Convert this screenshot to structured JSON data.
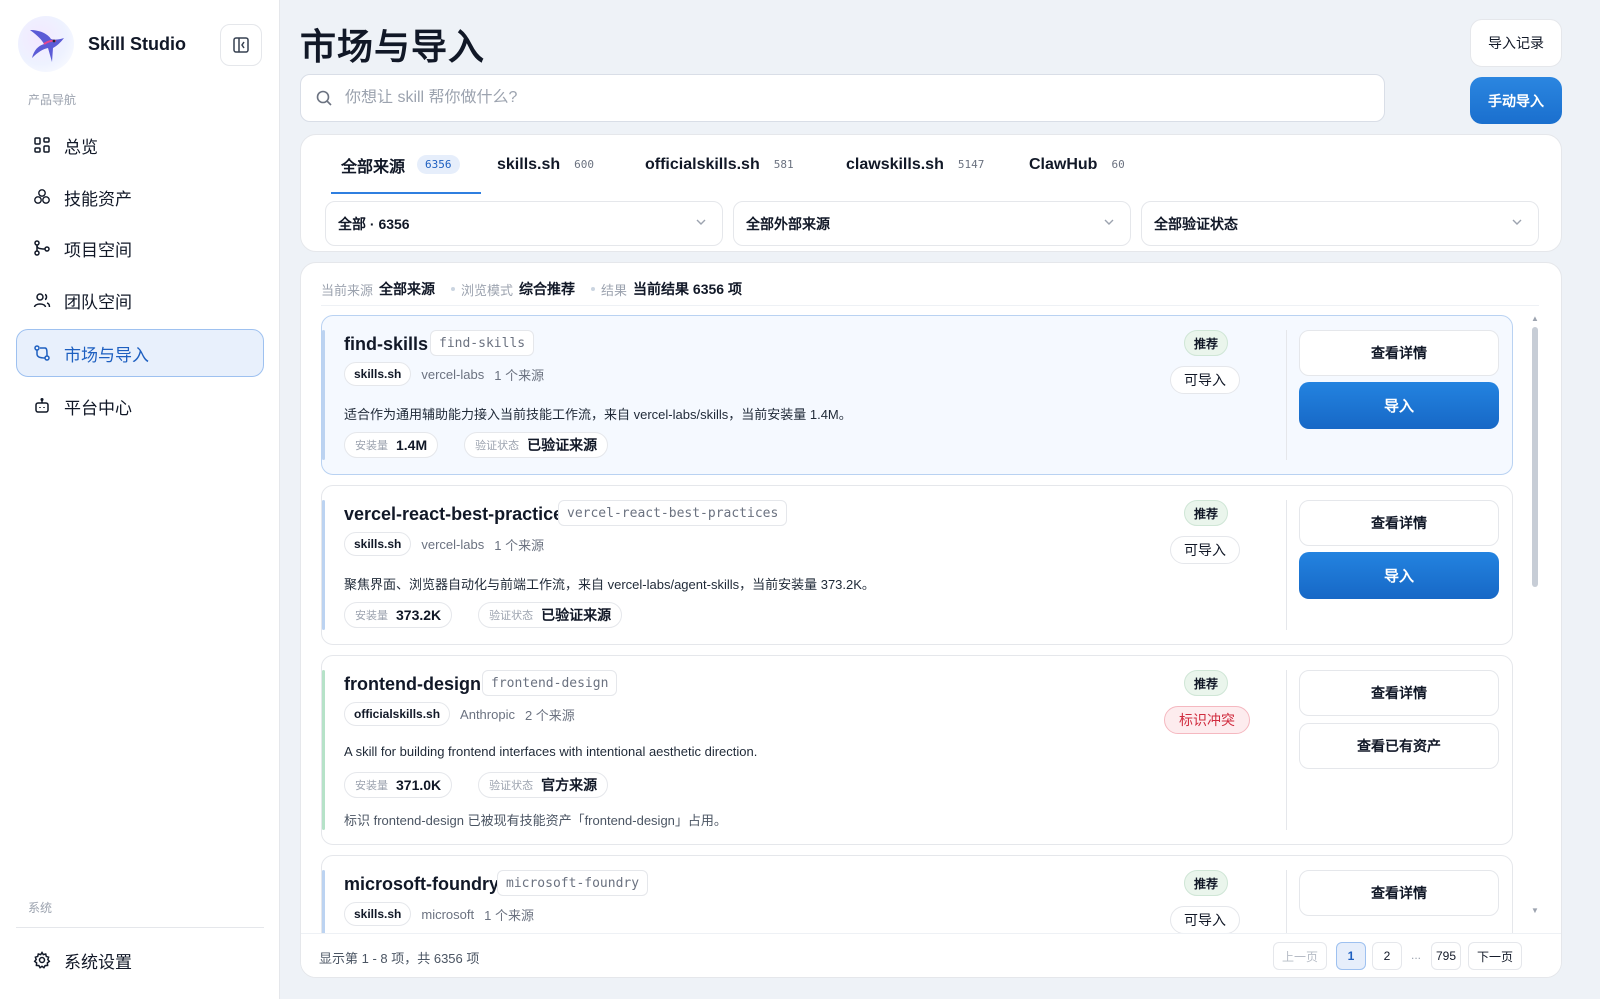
{
  "app": {
    "name": "Skill Studio"
  },
  "sidebar": {
    "section_product": "产品导航",
    "section_system": "系统",
    "items": [
      {
        "label": "总览",
        "icon": "grid-icon"
      },
      {
        "label": "技能资产",
        "icon": "cubes-icon"
      },
      {
        "label": "项目空间",
        "icon": "branch-icon"
      },
      {
        "label": "团队空间",
        "icon": "users-icon"
      },
      {
        "label": "市场与导入",
        "icon": "route-icon",
        "active": true
      },
      {
        "label": "平台中心",
        "icon": "bot-icon"
      }
    ],
    "settings": {
      "label": "系统设置",
      "icon": "gear-icon"
    }
  },
  "header": {
    "title": "市场与导入",
    "history_label": "导入记录",
    "manual_import_label": "手动导入"
  },
  "search": {
    "placeholder": "你想让 skill 帮你做什么?",
    "value": ""
  },
  "sources": {
    "tabs": [
      {
        "label": "全部来源",
        "count": "6356",
        "active": true
      },
      {
        "label": "skills.sh",
        "count": "600"
      },
      {
        "label": "officialskills.sh",
        "count": "581"
      },
      {
        "label": "clawskills.sh",
        "count": "5147"
      },
      {
        "label": "ClawHub",
        "count": "60"
      }
    ],
    "filters": [
      {
        "selected": "全部 · 6356"
      },
      {
        "selected": "全部外部来源"
      },
      {
        "selected": "全部验证状态"
      }
    ]
  },
  "results": {
    "meta": {
      "source_label": "当前来源",
      "source_value": "全部来源",
      "mode_label": "浏览模式",
      "mode_value": "综合推荐",
      "result_label": "结果",
      "result_value": "当前结果 6356 项"
    },
    "cards": [
      {
        "title": "find-skills",
        "slug": "find-skills",
        "source": "skills.sh",
        "owner": "vercel-labs",
        "source_count": "1 个来源",
        "description": "适合作为通用辅助能力接入当前技能工作流，来自 vercel-labs/skills，当前安装量 1.4M。",
        "installs_label": "安装量",
        "installs": "1.4M",
        "verify_label": "验证状态",
        "verify": "已验证来源",
        "badge": "推荐",
        "state": "可导入",
        "detail_label": "查看详情",
        "action_label": "导入"
      },
      {
        "title": "vercel-react-best-practices",
        "slug": "vercel-react-best-practices",
        "source": "skills.sh",
        "owner": "vercel-labs",
        "source_count": "1 个来源",
        "description": "聚焦界面、浏览器自动化与前端工作流，来自 vercel-labs/agent-skills，当前安装量 373.2K。",
        "installs_label": "安装量",
        "installs": "373.2K",
        "verify_label": "验证状态",
        "verify": "已验证来源",
        "badge": "推荐",
        "state": "可导入",
        "detail_label": "查看详情",
        "action_label": "导入"
      },
      {
        "title": "frontend-design",
        "slug": "frontend-design",
        "source": "officialskills.sh",
        "owner": "Anthropic",
        "source_count": "2 个来源",
        "description": "A skill for building frontend interfaces with intentional aesthetic direction.",
        "installs_label": "安装量",
        "installs": "371.0K",
        "verify_label": "验证状态",
        "verify": "官方来源",
        "note": "标识 frontend-design 已被现有技能资产「frontend-design」占用。",
        "badge": "推荐",
        "state": "标识冲突",
        "detail_label": "查看详情",
        "action_label": "查看已有资产"
      },
      {
        "title": "microsoft-foundry",
        "slug": "microsoft-foundry",
        "source": "skills.sh",
        "owner": "microsoft",
        "source_count": "1 个来源",
        "badge": "推荐",
        "state": "可导入",
        "detail_label": "查看详情"
      }
    ]
  },
  "pagination": {
    "info": "显示第 1 - 8 项，共 6356 项",
    "prev": "上一页",
    "next": "下一页",
    "pages": [
      "1",
      "2",
      "...",
      "795"
    ],
    "current": "1"
  },
  "colors": {
    "accent": "#1d6fd0",
    "active_bg": "#e8f0fc",
    "danger": "#d02b3e",
    "recommend_bg": "#eaf5ec"
  }
}
